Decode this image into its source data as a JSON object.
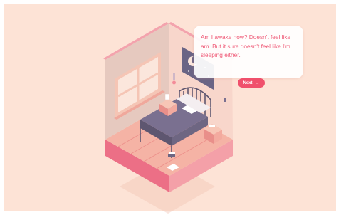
{
  "dialog": {
    "text": "Am I awake now? Doesn't feel like I am. But it sure doesn't feel like I'm sleeping either.",
    "next_label": "Next",
    "next_arrow": "→"
  },
  "scene": {
    "subject": "isometric bedroom",
    "objects": [
      "window",
      "bed",
      "pillow",
      "nightstand",
      "lamp",
      "night-sky-poster",
      "wall-lamp",
      "books",
      "floor-rug-paper"
    ]
  },
  "colors": {
    "background": "#fde3d6",
    "accent": "#f0506c",
    "dialog_text": "#ef5a77",
    "floor": "#f5b3a5",
    "wall_left": "#e6c9bf",
    "wall_back": "#f8d6cb",
    "bed_blanket": "#7a7090"
  }
}
